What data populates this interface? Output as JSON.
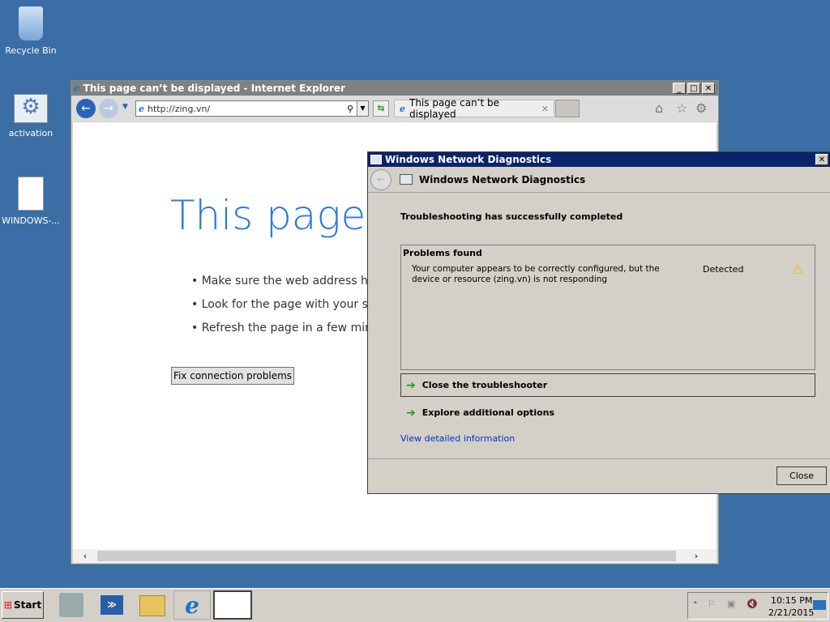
{
  "desktop": {
    "icons": [
      {
        "label": "Recycle Bin"
      },
      {
        "label": "activation"
      },
      {
        "label": "WINDOWS-..."
      }
    ]
  },
  "ie": {
    "title": "This page can’t be displayed - Internet Explorer",
    "address": "http://zing.vn/",
    "tab_label": "This page can’t be displayed",
    "heading": "This page c",
    "bullets": [
      "Make sure the web address ht",
      "Look for the page with your se",
      "Refresh the page in a few minu"
    ],
    "fix_button": "Fix connection problems"
  },
  "dialog": {
    "title": "Windows Network Diagnostics",
    "header": "Windows Network Diagnostics",
    "status": "Troubleshooting has successfully completed",
    "problems_heading": "Problems found",
    "problem_text": "Your computer appears to be correctly configured, but the device or resource (zing.vn) is not responding",
    "problem_status": "Detected",
    "close_troubleshooter": "Close the troubleshooter",
    "explore_options": "Explore additional options",
    "detail_link": "View detailed information",
    "close_button": "Close"
  },
  "taskbar": {
    "start": "Start",
    "time": "10:15 PM",
    "date": "2/21/2015"
  },
  "colors": {
    "desktop": "#3a6ea5",
    "dialog_title": "#0a246a",
    "link": "#0033cc",
    "heading": "#2a7ae2"
  }
}
